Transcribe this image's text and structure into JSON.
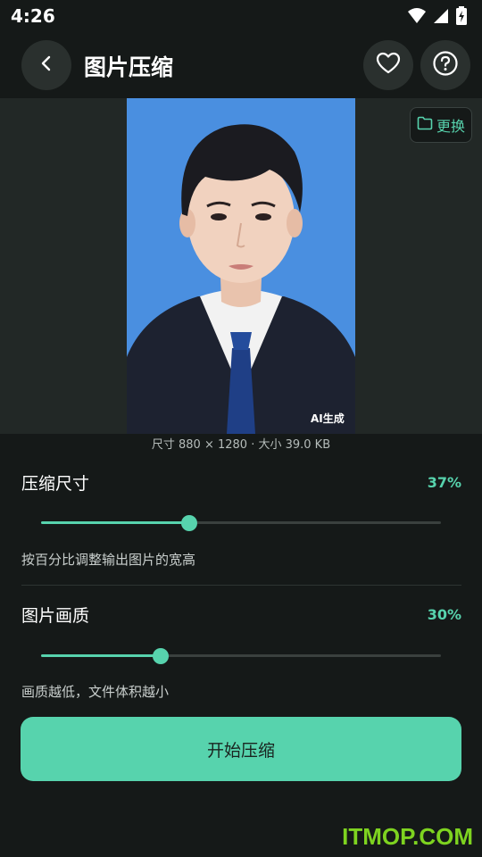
{
  "status_bar": {
    "time": "4:26",
    "icons": [
      "wifi-icon",
      "signal-icon",
      "battery-charging-icon"
    ]
  },
  "app_bar": {
    "title": "图片压缩",
    "back_icon": "chevron-left-icon",
    "favorite_icon": "heart-icon",
    "help_icon": "question-circle-icon"
  },
  "preview": {
    "replace_label": "更换",
    "replace_icon": "folder-icon",
    "ai_badge": "AI生成",
    "image_info": "尺寸 880 × 1280 · 大小 39.0 KB"
  },
  "size_section": {
    "label": "压缩尺寸",
    "percent_text": "37%",
    "value": 0.37,
    "hint": "按百分比调整输出图片的宽高"
  },
  "quality_section": {
    "label": "图片画质",
    "percent_text": "30%",
    "value": 0.3,
    "hint": "画质越低，文件体积越小"
  },
  "start_button": {
    "label": "开始压缩"
  },
  "watermark": "ITMOP.COM",
  "colors": {
    "accent": "#57d3ad",
    "background": "#151918",
    "photo_background": "#4a8fe0",
    "watermark": "#7ed320"
  }
}
